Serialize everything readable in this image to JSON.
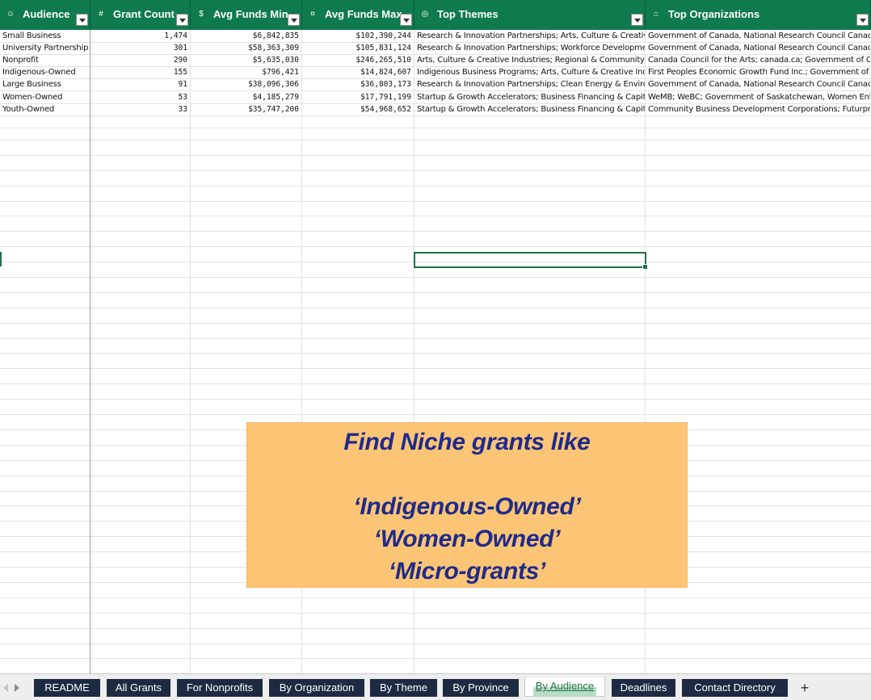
{
  "columns": [
    {
      "id": "audience",
      "label": "Audience",
      "icon": "people-icon"
    },
    {
      "id": "grant_count",
      "label": "Grant Count",
      "icon": "numbers-icon"
    },
    {
      "id": "avg_min",
      "label": "Avg Funds Min",
      "icon": "money-icon"
    },
    {
      "id": "avg_max",
      "label": "Avg Funds Max",
      "icon": "money-bag-icon"
    },
    {
      "id": "top_themes",
      "label": "Top Themes",
      "icon": "target-icon"
    },
    {
      "id": "top_orgs",
      "label": "Top Organizations",
      "icon": "institution-icon"
    }
  ],
  "rows": [
    [
      "Small Business",
      "1,474",
      "$6,842,835",
      "$102,390,244",
      "Research & Innovation Partnerships; Arts, Culture & Creative In",
      "Government of Canada, National Research Council Canada; Go"
    ],
    [
      "University Partnership",
      "301",
      "$58,363,309",
      "$105,831,124",
      "Research & Innovation Partnerships; Workforce Development &",
      "Government of Canada, National Research Council Canada; CR"
    ],
    [
      "Nonprofit",
      "290",
      "$5,635,030",
      "$246,265,510",
      "Arts, Culture & Creative Industries; Regional & Community Dev",
      "Canada Council for the Arts; canada.ca; Government of Canada"
    ],
    [
      "Indigenous-Owned",
      "155",
      "$796,421",
      "$14,824,607",
      "Indigenous Business Programs; Arts, Culture & Creative Industr",
      "First Peoples Economic Growth Fund Inc.; Government of Can"
    ],
    [
      "Large Business",
      "91",
      "$38,096,306",
      "$36,803,173",
      "Research & Innovation Partnerships; Clean Energy & Environme",
      "Government of Canada, National Research Council Canada; Go"
    ],
    [
      "Women-Owned",
      "53",
      "$4,185,279",
      "$17,791,199",
      "Startup & Growth Accelerators; Business Financing & Capital; In",
      "WeMB; WeBC; Government of Saskatchewan, Women Entrepr"
    ],
    [
      "Youth-Owned",
      "33",
      "$35,747,200",
      "$54,968,652",
      "Startup & Growth Accelerators; Business Financing & Capital; W",
      "Community Business Development Corporations; Futurprene"
    ]
  ],
  "callout": {
    "title": "Find Niche grants like",
    "lines": [
      "‘Indigenous-Owned’",
      "‘Women-Owned’",
      "‘Micro-grants’"
    ]
  },
  "tabs": [
    {
      "label": "README",
      "active": false
    },
    {
      "label": "All Grants",
      "active": false
    },
    {
      "label": "For Nonprofits",
      "active": false
    },
    {
      "label": "By Organization",
      "active": false
    },
    {
      "label": "By Theme",
      "active": false
    },
    {
      "label": "By Province",
      "active": false
    },
    {
      "label": "By Audience",
      "active": true
    },
    {
      "label": "Deadlines",
      "active": false
    },
    {
      "label": "Contact Directory",
      "active": false
    }
  ],
  "add_sheet_label": "+",
  "colors": {
    "header_bg": "#0f7a4e",
    "tab_bg": "#1c2b42",
    "callout_bg": "#fcc576",
    "callout_text": "#1f2b8a",
    "selection": "#1e7145"
  }
}
